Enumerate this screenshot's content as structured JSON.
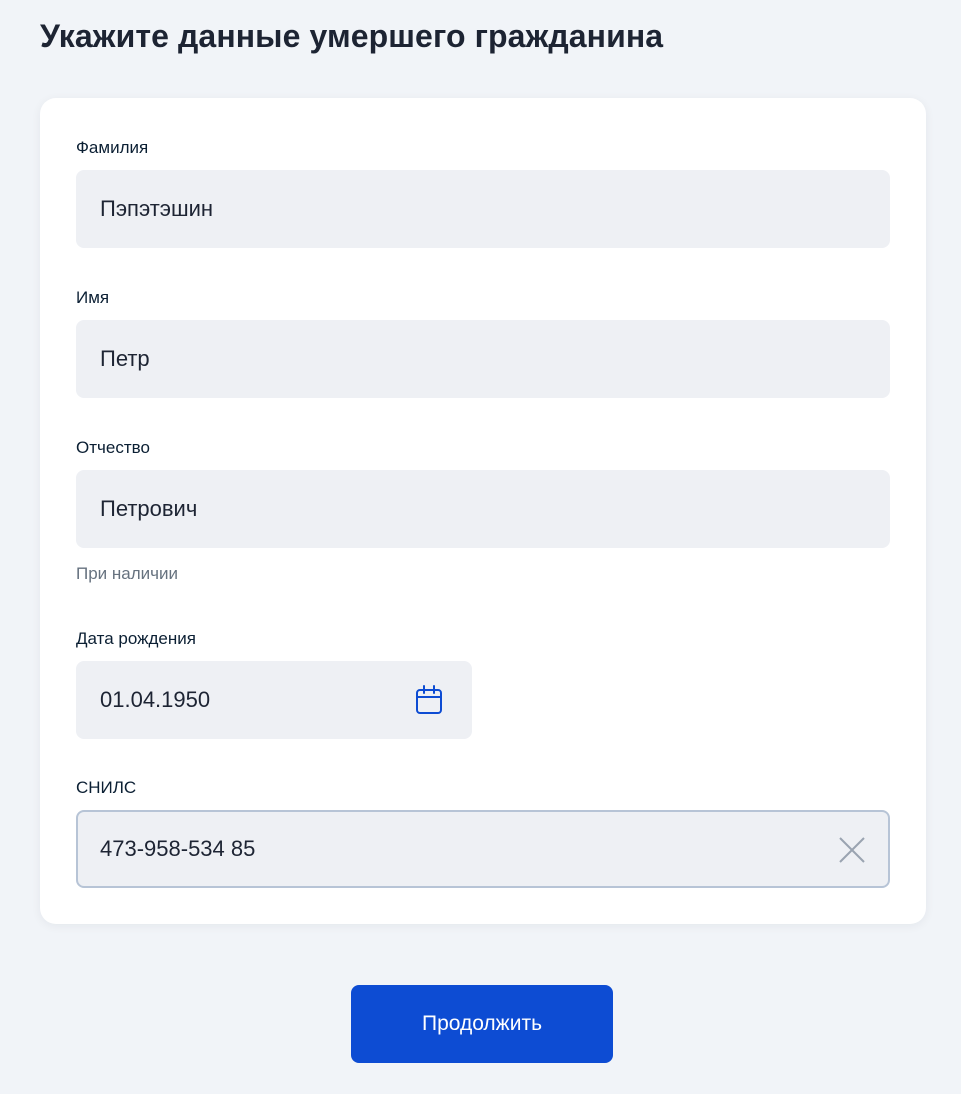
{
  "page": {
    "title": "Укажите данные умершего гражданина"
  },
  "form": {
    "surname": {
      "label": "Фамилия",
      "value": "Пэпэтэшин"
    },
    "name": {
      "label": "Имя",
      "value": "Петр"
    },
    "patronymic": {
      "label": "Отчество",
      "value": "Петрович",
      "hint": "При наличии"
    },
    "birth_date": {
      "label": "Дата рождения",
      "value": "01.04.1950",
      "icon": "calendar-icon"
    },
    "snils": {
      "label": "СНИЛС",
      "value": "473-958-534 85",
      "icon": "close-icon"
    }
  },
  "actions": {
    "continue_label": "Продолжить"
  },
  "colors": {
    "accent": "#0d4cd3",
    "field_bg": "#eef0f4",
    "page_bg": "#f1f4f8",
    "icon": "#0d4cd3"
  }
}
